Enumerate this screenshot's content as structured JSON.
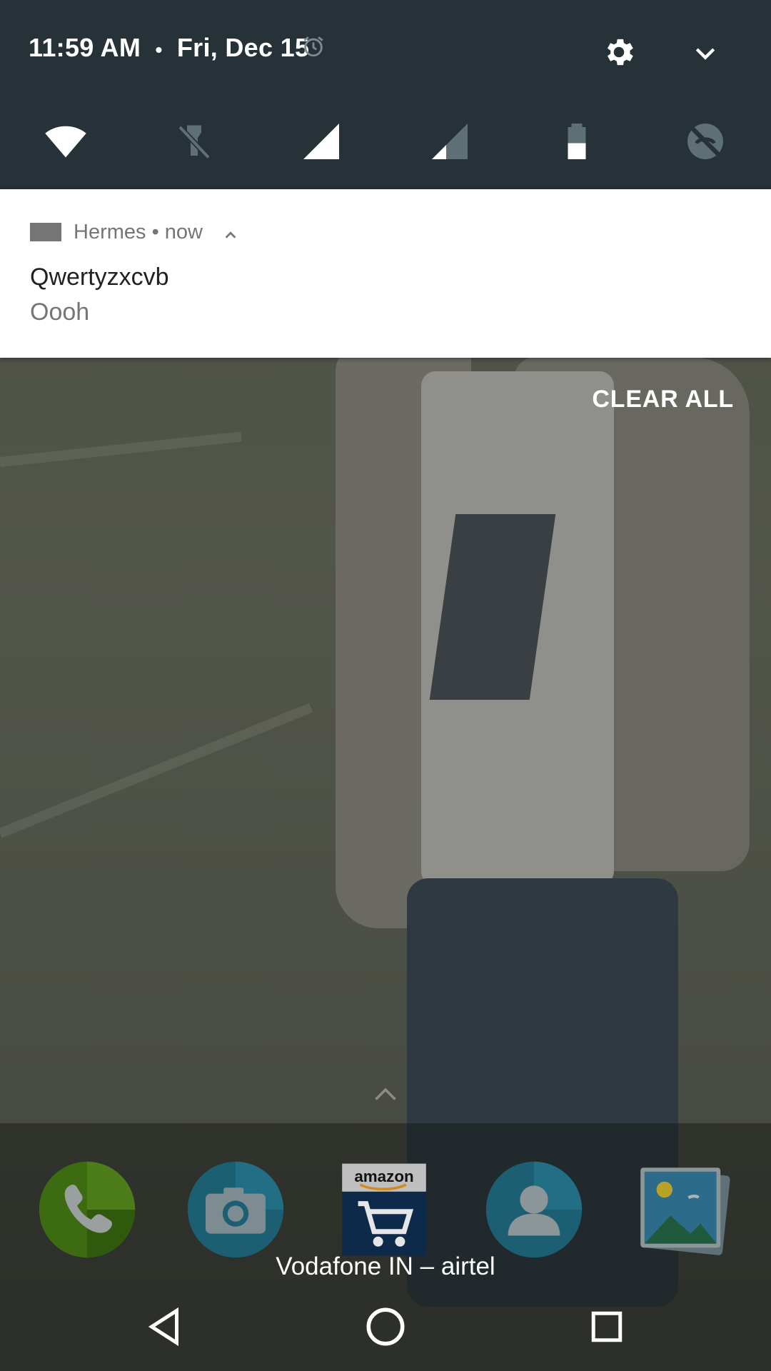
{
  "status": {
    "time": "11:59 AM",
    "separator": "•",
    "date": "Fri, Dec 15",
    "icons": [
      "alarm-icon",
      "settings-gear-icon",
      "expand-chevron-icon"
    ]
  },
  "quick_settings": {
    "tiles": [
      "wifi-icon",
      "flashlight-off-icon",
      "cell-signal-full-icon",
      "cell-signal-partial-icon",
      "battery-icon",
      "auto-rotate-off-icon"
    ]
  },
  "notification": {
    "app_name": "Hermes",
    "time": "now",
    "header": "Hermes • now",
    "title": "Qwertyzxcvb",
    "text": "Oooh"
  },
  "clear_all_label": "CLEAR ALL",
  "dock": {
    "apps": [
      "phone-app-icon",
      "camera-app-icon",
      "amazon-app-icon",
      "contacts-app-icon",
      "gallery-app-icon"
    ],
    "amazon_label": "amazon",
    "carrier": "Vodafone IN – airtel"
  },
  "nav": [
    "back-icon",
    "home-icon",
    "recents-icon"
  ],
  "colors": {
    "qs_background": "#263238",
    "notification_background": "#ffffff",
    "secondary_text": "#757575",
    "primary_text": "#212121"
  }
}
